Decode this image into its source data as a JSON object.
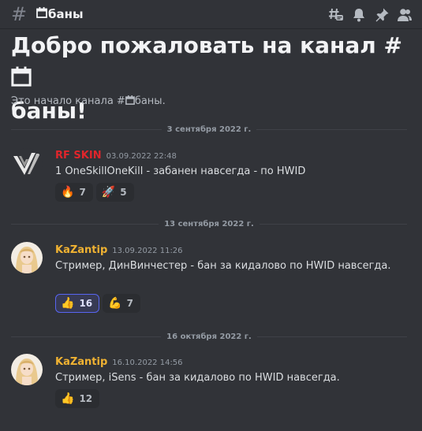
{
  "header": {
    "hash_glyph": "#",
    "channel_name": "баны",
    "toolbar": [
      {
        "name": "threads-icon"
      },
      {
        "name": "bell-icon"
      },
      {
        "name": "pin-icon"
      },
      {
        "name": "members-icon"
      }
    ]
  },
  "welcome": {
    "title_prefix": "Добро пожаловать на канал #",
    "title_suffix": "баны!",
    "subtitle_prefix": "Это начало канала #",
    "subtitle_suffix": "баны."
  },
  "dividers": [
    "3 сентября 2022 г.",
    "13 сентября 2022 г.",
    "16 октября 2022 г."
  ],
  "messages": [
    {
      "author": "RF SKIN",
      "author_color": "#e0252b",
      "timestamp": "03.09.2022 22:48",
      "text": "1 OneSkillOneKill - забанен навсегда - по HWID",
      "reactions": [
        {
          "emoji": "🔥",
          "count": "7",
          "active": false
        },
        {
          "emoji": "🚀",
          "count": "5",
          "active": false
        }
      ]
    },
    {
      "author": "KaZantip",
      "author_color": "#f0b232",
      "timestamp": "13.09.2022 11:26",
      "text": "Стример, ДинВинчестер - бан за кидалово по HWID навсегда.",
      "reactions": [
        {
          "emoji": "👍",
          "count": "16",
          "active": true
        },
        {
          "emoji": "💪",
          "count": "7",
          "active": false
        }
      ]
    },
    {
      "author": "KaZantip",
      "author_color": "#f0b232",
      "timestamp": "16.10.2022 14:56",
      "text": "Стример, iSens - бан за кидалово по HWID навсегда.",
      "reactions": [
        {
          "emoji": "👍",
          "count": "12",
          "active": false
        }
      ]
    }
  ]
}
